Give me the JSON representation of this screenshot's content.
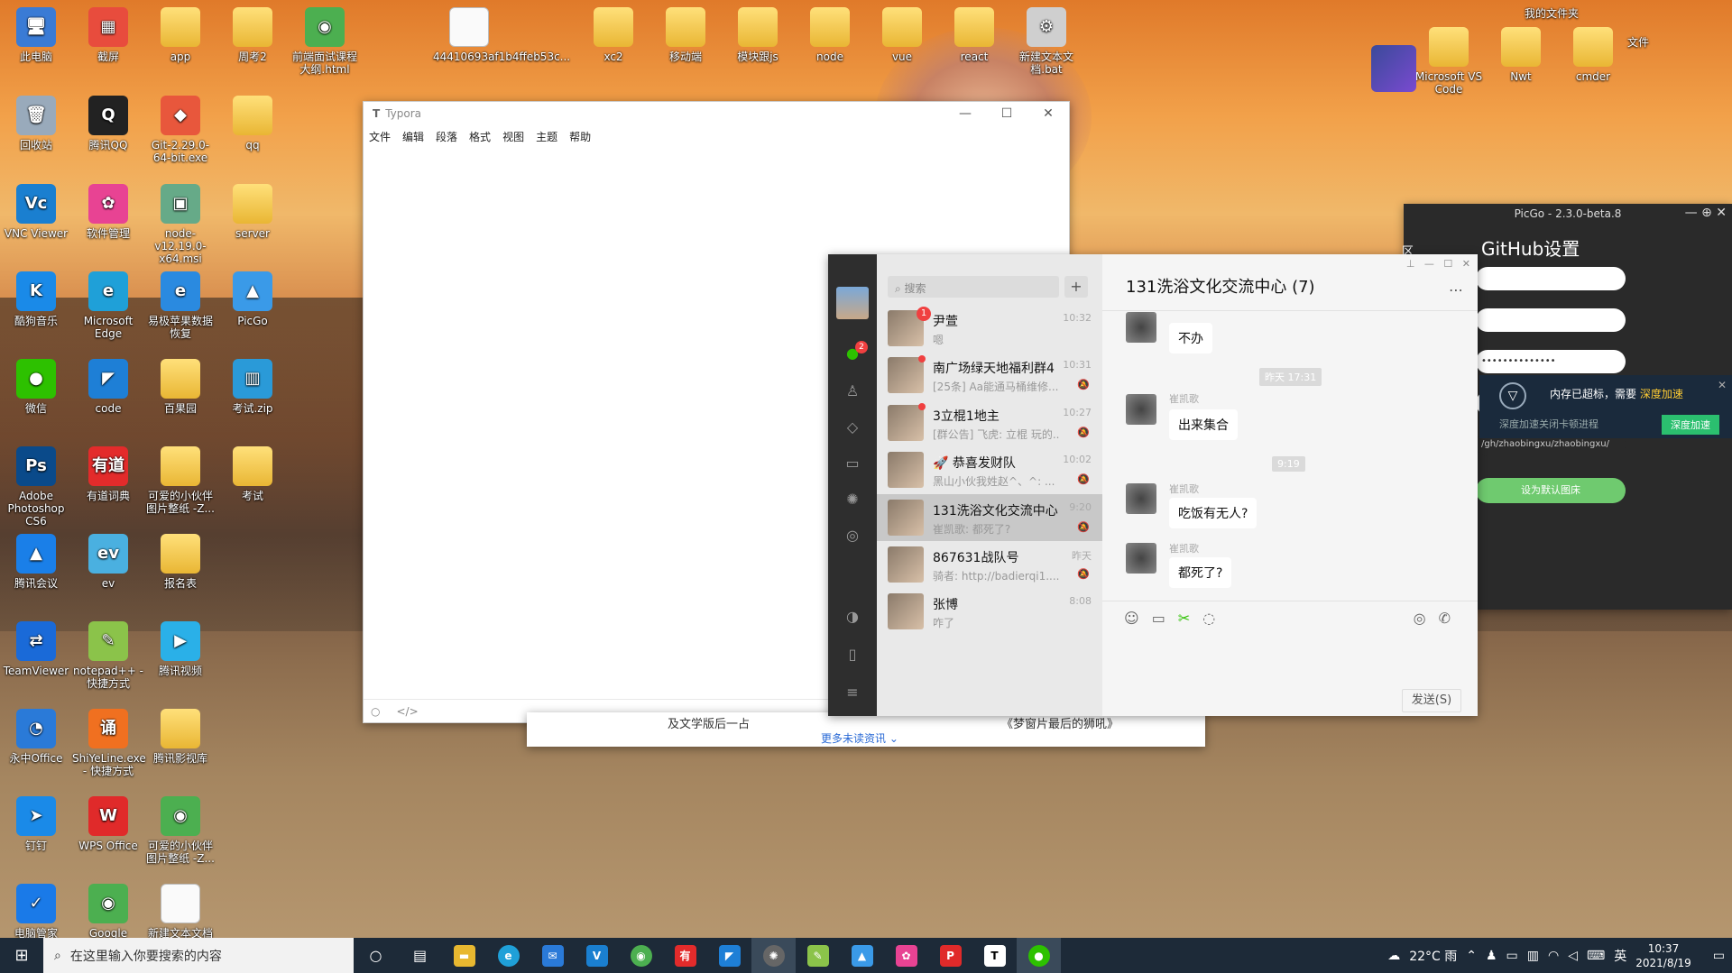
{
  "desktop": {
    "icons": [
      {
        "label": "此电脑",
        "glyph": "🖥",
        "color": "#3a7bd5",
        "kind": "app"
      },
      {
        "label": "截屏",
        "glyph": "▦",
        "color": "#e84c3d",
        "kind": "app"
      },
      {
        "label": "app",
        "glyph": "",
        "color": "",
        "kind": "folder"
      },
      {
        "label": "周考2",
        "glyph": "",
        "color": "",
        "kind": "folder"
      },
      {
        "label": "前端面试课程大纲.html",
        "glyph": "◉",
        "color": "#4caf50",
        "kind": "app"
      },
      {
        "label": "44410693af1b4ffeb53c...",
        "glyph": "",
        "color": "",
        "kind": "file"
      },
      {
        "label": "xc2",
        "glyph": "",
        "color": "",
        "kind": "folder"
      },
      {
        "label": "移动端",
        "glyph": "",
        "color": "",
        "kind": "folder"
      },
      {
        "label": "模块跟js",
        "glyph": "",
        "color": "",
        "kind": "folder"
      },
      {
        "label": "node",
        "glyph": "",
        "color": "",
        "kind": "folder"
      },
      {
        "label": "vue",
        "glyph": "",
        "color": "",
        "kind": "folder"
      },
      {
        "label": "react",
        "glyph": "",
        "color": "",
        "kind": "folder"
      },
      {
        "label": "新建文本文档.bat",
        "glyph": "⚙",
        "color": "#cfcfcf",
        "kind": "app"
      },
      {
        "label": "回收站",
        "glyph": "🗑",
        "color": "#9ab",
        "kind": "app"
      },
      {
        "label": "腾讯QQ",
        "glyph": "Q",
        "color": "#222",
        "kind": "app"
      },
      {
        "label": "Git-2.29.0-64-bit.exe",
        "glyph": "◆",
        "color": "#e8573c",
        "kind": "app"
      },
      {
        "label": "qq",
        "glyph": "",
        "color": "",
        "kind": "folder"
      },
      {
        "label": "VNC Viewer",
        "glyph": "Vc",
        "color": "#1a7fd0",
        "kind": "app"
      },
      {
        "label": "软件管理",
        "glyph": "✿",
        "color": "#e84393",
        "kind": "app"
      },
      {
        "label": "node-v12.19.0-x64.msi",
        "glyph": "▣",
        "color": "#6a8",
        "kind": "app"
      },
      {
        "label": "server",
        "glyph": "",
        "color": "",
        "kind": "folder"
      },
      {
        "label": "酷狗音乐",
        "glyph": "K",
        "color": "#1a8ae8",
        "kind": "app"
      },
      {
        "label": "Microsoft Edge",
        "glyph": "e",
        "color": "#1fa0d8",
        "kind": "app"
      },
      {
        "label": "易极苹果数据恢复",
        "glyph": "e",
        "color": "#2a8ae0",
        "kind": "app"
      },
      {
        "label": "PicGo",
        "glyph": "▲",
        "color": "#3a9ae8",
        "kind": "app"
      },
      {
        "label": "微信",
        "glyph": "●",
        "color": "#2dc100",
        "kind": "app"
      },
      {
        "label": "code",
        "glyph": "◤",
        "color": "#1e7fd6",
        "kind": "app"
      },
      {
        "label": "百果园",
        "glyph": "",
        "color": "",
        "kind": "folder"
      },
      {
        "label": "考试.zip",
        "glyph": "▥",
        "color": "#2a9ad8",
        "kind": "app"
      },
      {
        "label": "Adobe Photoshop CS6",
        "glyph": "Ps",
        "color": "#0a4a8a",
        "kind": "app"
      },
      {
        "label": "有道词典",
        "glyph": "有道",
        "color": "#e32b2b",
        "kind": "app"
      },
      {
        "label": "可爱的小伙伴图片整纸 -Z...",
        "glyph": "",
        "color": "",
        "kind": "folder"
      },
      {
        "label": "考试",
        "glyph": "",
        "color": "",
        "kind": "folder"
      },
      {
        "label": "腾讯会议",
        "glyph": "▲",
        "color": "#1a7fe8",
        "kind": "app"
      },
      {
        "label": "ev",
        "glyph": "ev",
        "color": "#4ab0e0",
        "kind": "app"
      },
      {
        "label": "报名表",
        "glyph": "",
        "color": "",
        "kind": "folder"
      },
      {
        "label": "TeamViewer",
        "glyph": "⇄",
        "color": "#1a6ad8",
        "kind": "app"
      },
      {
        "label": "notepad++ - 快捷方式",
        "glyph": "✎",
        "color": "#8bc34a",
        "kind": "app"
      },
      {
        "label": "腾讯视频",
        "glyph": "▶",
        "color": "#2ab0e8",
        "kind": "app"
      },
      {
        "label": "永中Office",
        "glyph": "◔",
        "color": "#2a7ad8",
        "kind": "app"
      },
      {
        "label": "ShiYeLine.exe - 快捷方式",
        "glyph": "诵",
        "color": "#f07020",
        "kind": "app"
      },
      {
        "label": "腾讯影视库",
        "glyph": "",
        "color": "",
        "kind": "folder"
      },
      {
        "label": "钉钉",
        "glyph": "➤",
        "color": "#1a8ae8",
        "kind": "app"
      },
      {
        "label": "WPS Office",
        "glyph": "W",
        "color": "#e02a2a",
        "kind": "app"
      },
      {
        "label": "可爱的小伙伴图片整纸 -Z...",
        "glyph": "◉",
        "color": "#4caf50",
        "kind": "app"
      },
      {
        "label": "电脑管家",
        "glyph": "✓",
        "color": "#1a7ae8",
        "kind": "app"
      },
      {
        "label": "Google Chrome",
        "glyph": "◉",
        "color": "#4caf50",
        "kind": "app"
      },
      {
        "label": "新建文本文档",
        "glyph": "",
        "color": "",
        "kind": "file"
      },
      {
        "label": "我的文件夹",
        "glyph": "",
        "color": "",
        "kind": "label"
      },
      {
        "label": "Microsoft VS Code",
        "glyph": "",
        "color": "",
        "kind": "folder"
      },
      {
        "label": "Nwt",
        "glyph": "",
        "color": "",
        "kind": "folder"
      },
      {
        "label": "cmder",
        "glyph": "",
        "color": "",
        "kind": "folder"
      },
      {
        "label": "文件",
        "glyph": "",
        "color": "",
        "kind": "label"
      }
    ]
  },
  "typora": {
    "app_name": "Typora",
    "menu": [
      "文件",
      "编辑",
      "段落",
      "格式",
      "视图",
      "主题",
      "帮助"
    ],
    "footer_icons": [
      "○",
      "</>"
    ]
  },
  "news": {
    "left_text": "及文学版后一占",
    "right_text": "《梦窗片最后的狮吼》",
    "more": "更多未读资讯"
  },
  "picgo": {
    "title": "PicGo - 2.3.0-beta.8",
    "heading": "GitHub设置",
    "token_masked": "••••••••••••••",
    "path_value": "/gh/zhaobingxu/zhaobingxu/",
    "default_btn": "设为默认图床",
    "side_char": "区"
  },
  "toast": {
    "line1": "内存已超标，需要",
    "highlight": "深度加速",
    "line2": "深度加速关闭卡顿进程",
    "button": "深度加速",
    "close": "✕"
  },
  "wechat": {
    "search_placeholder": "搜索",
    "chats": [
      {
        "name": "尹萱",
        "msg": "嗯",
        "time": "10:32",
        "badge": "1",
        "dot": false,
        "mute": false
      },
      {
        "name": "南广场绿天地福利群4",
        "msg": "[25条] Aa能通马桶维修...",
        "time": "10:31",
        "badge": "",
        "dot": true,
        "mute": true
      },
      {
        "name": "3立棍1地主",
        "msg": "[群公告] 飞虎: 立棍 玩的...",
        "time": "10:27",
        "badge": "",
        "dot": true,
        "mute": true
      },
      {
        "name": "🚀 恭喜发财队",
        "msg": "黑山小伙我姓赵^、^: ...",
        "time": "10:02",
        "badge": "",
        "dot": false,
        "mute": true
      },
      {
        "name": "131洗浴文化交流中心",
        "msg": "崔凯歌: 都死了?",
        "time": "9:20",
        "badge": "",
        "dot": false,
        "mute": true
      },
      {
        "name": "867631战队号",
        "msg": "骑者: http://badierqi1....",
        "time": "昨天",
        "badge": "",
        "dot": false,
        "mute": true
      },
      {
        "name": "张博",
        "msg": "咋了",
        "time": "8:08",
        "badge": "",
        "dot": false,
        "mute": false
      }
    ],
    "sidebar_badge": "2",
    "chat_title": "131洗浴文化交流中心 (7)",
    "messages": [
      {
        "sender": "",
        "text": "不办"
      },
      {
        "sender": "崔凯歌",
        "text": "出来集合"
      },
      {
        "sender": "崔凯歌",
        "text": "吃饭有无人?"
      },
      {
        "sender": "崔凯歌",
        "text": "都死了?"
      }
    ],
    "time_sep1": "昨天 17:31",
    "time_sep2": "9:19",
    "send_label": "发送(S)"
  },
  "taskbar": {
    "search_placeholder": "在这里输入你要搜索的内容",
    "weather": "22°C 雨",
    "ime": "英",
    "time": "10:37",
    "date": "2021/8/19"
  }
}
